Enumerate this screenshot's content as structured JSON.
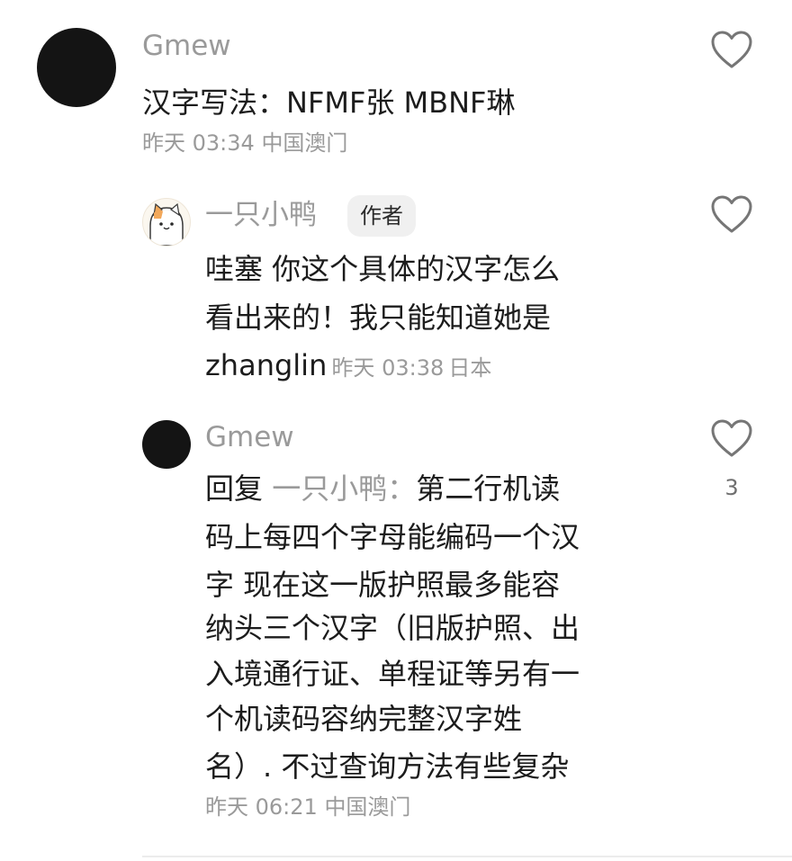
{
  "comments": [
    {
      "username": "Gmew",
      "text": "汉字写法：NFMF张 MBNF琳",
      "time": "昨天 03:34",
      "location": "中国澳门",
      "like_icon": "heart-outline-icon"
    },
    {
      "username": "一只小鸭",
      "badge": "作者",
      "lines": [
        "哇塞 你这个具体的汉字怎么",
        "看出来的！我只能知道她是"
      ],
      "last_line": "zhanglin",
      "time": "昨天 03:38",
      "location": "日本",
      "like_icon": "heart-outline-icon"
    },
    {
      "username": "Gmew",
      "reply_prefix": "回复",
      "reply_target": "一只小鸭",
      "reply_sep": "：",
      "first_line_rest": "第二行机读",
      "lines": [
        "码上每四个字母能编码一个汉",
        "字 现在这一版护照最多能容",
        "纳头三个汉字（旧版护照、出",
        "入境通行证、单程证等另有一",
        "个机读码容纳完整汉字姓",
        "名）. 不过查询方法有些复杂"
      ],
      "time": "昨天 06:21",
      "location": "中国澳门",
      "like_icon": "heart-outline-icon",
      "like_count": "3"
    }
  ]
}
